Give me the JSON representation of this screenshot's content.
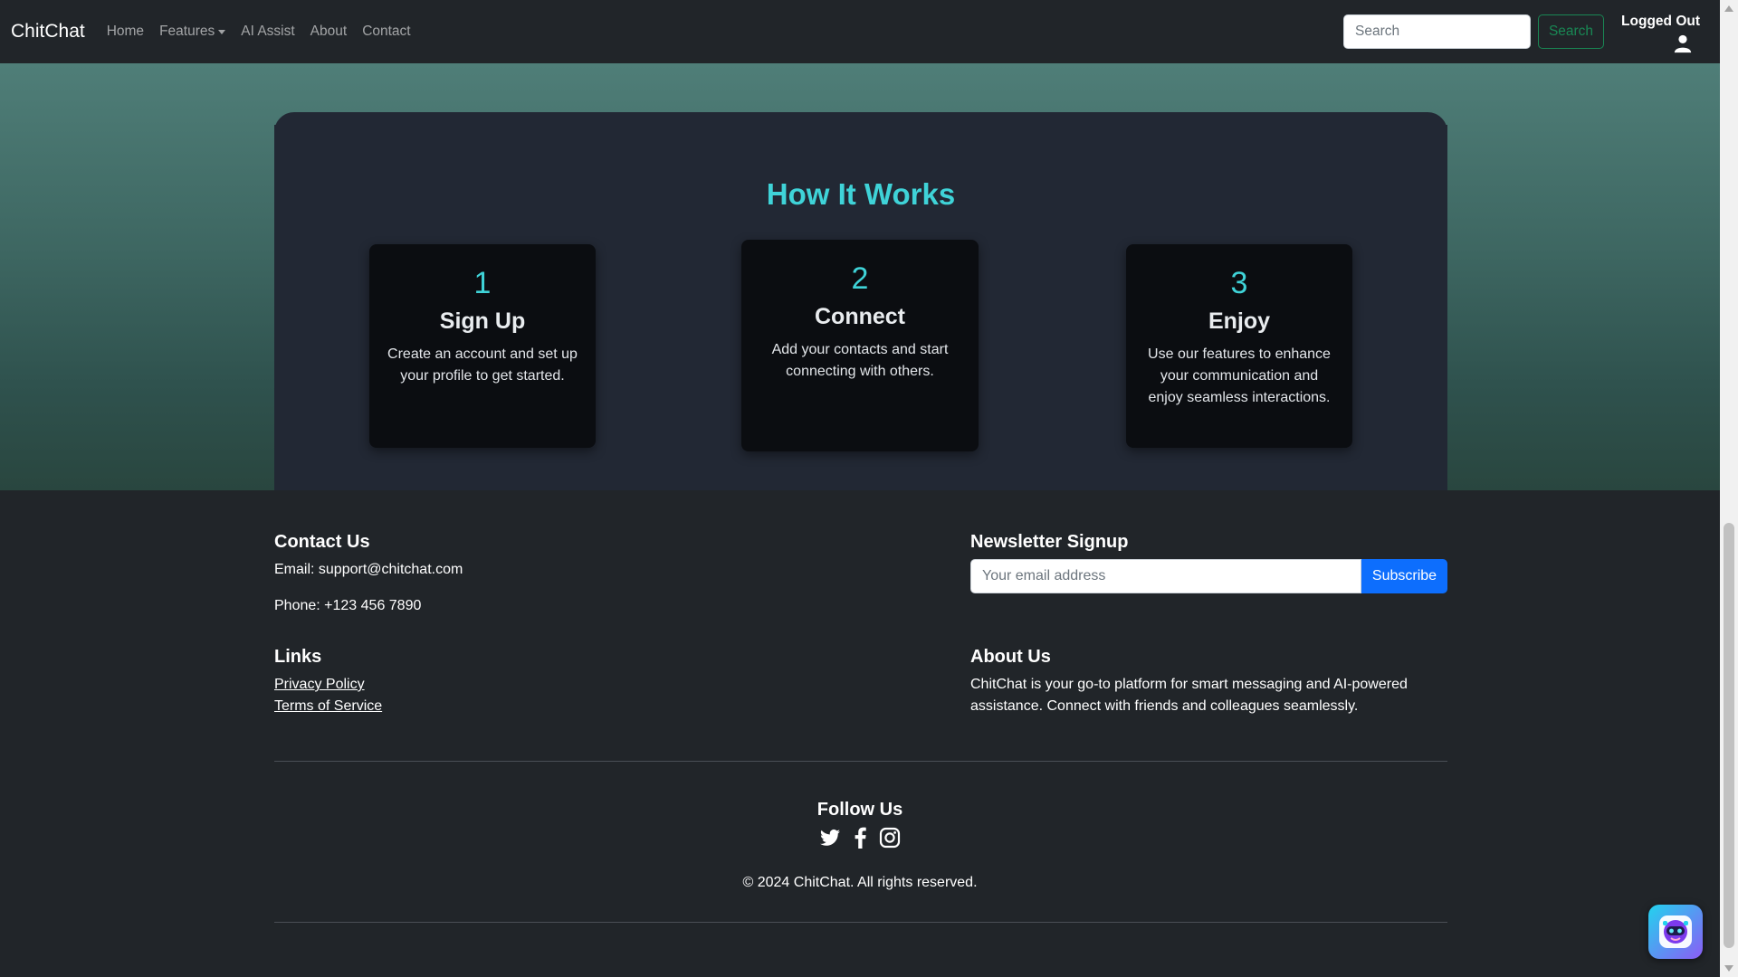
{
  "navbar": {
    "brand": "ChitChat",
    "links": [
      "Home",
      "Features",
      "AI Assist",
      "About",
      "Contact"
    ],
    "search_placeholder": "Search",
    "search_button": "Search",
    "user_status": "Logged Out",
    "user_icon": "user-icon"
  },
  "how_it_works": {
    "title": "How It Works",
    "steps": [
      {
        "number": "1",
        "title": "Sign Up",
        "description": "Create an account and set up your profile to get started."
      },
      {
        "number": "2",
        "title": "Connect",
        "description": "Add your contacts and start connecting with others."
      },
      {
        "number": "3",
        "title": "Enjoy",
        "description": "Use our features to enhance your communication and enjoy seamless interactions."
      }
    ]
  },
  "footer": {
    "contact": {
      "heading": "Contact Us",
      "email": "Email: support@chitchat.com",
      "phone": "Phone: +123 456 7890"
    },
    "newsletter": {
      "heading": "Newsletter Signup",
      "placeholder": "Your email address",
      "button": "Subscribe"
    },
    "links": {
      "heading": "Links",
      "items": [
        "Privacy Policy",
        "Terms of Service"
      ]
    },
    "about": {
      "heading": "About Us",
      "text_line1": "ChitChat is your go-to platform for smart messaging and AI-powered",
      "text_line2": "assistance. Connect with friends and colleagues seamlessly."
    },
    "follow": {
      "heading": "Follow Us",
      "icons": [
        "twitter-icon",
        "facebook-icon",
        "instagram-icon"
      ]
    },
    "copyright": "© 2024 ChitChat. All rights reserved."
  },
  "colors": {
    "accent": "#3fd3d8",
    "primary_button": "#0d6efd",
    "success_outline": "#198754",
    "background": "#212529"
  },
  "chatbot": {
    "icon": "robot-icon"
  }
}
